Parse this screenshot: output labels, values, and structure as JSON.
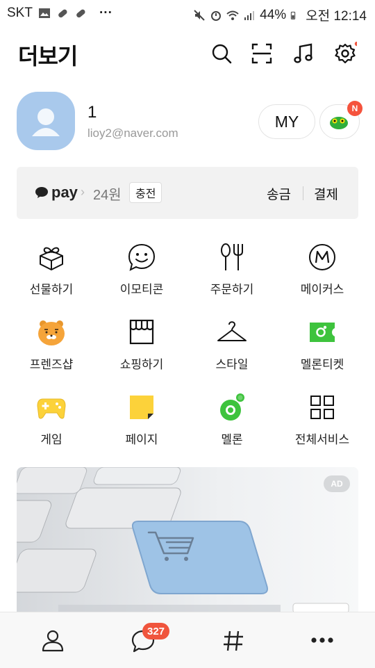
{
  "status_bar": {
    "carrier": "SKT",
    "more_notifications": "···",
    "battery": "44%",
    "time": "오전 12:14"
  },
  "header": {
    "title": "더보기"
  },
  "profile": {
    "name": "1",
    "email": "lioy2@naver.com",
    "my_label": "MY",
    "badge": "N"
  },
  "pay": {
    "logo": "pay",
    "amount": "24원",
    "charge": "충전",
    "send": "송금",
    "payment": "결제"
  },
  "grid": [
    {
      "label": "선물하기",
      "icon": "gift-icon"
    },
    {
      "label": "이모티콘",
      "icon": "emoticon-icon"
    },
    {
      "label": "주문하기",
      "icon": "fork-spoon-icon"
    },
    {
      "label": "메이커스",
      "icon": "makers-icon"
    },
    {
      "label": "프렌즈샵",
      "icon": "ryan-icon"
    },
    {
      "label": "쇼핑하기",
      "icon": "shop-icon"
    },
    {
      "label": "스타일",
      "icon": "hanger-icon"
    },
    {
      "label": "멜론티켓",
      "icon": "melon-ticket-icon"
    },
    {
      "label": "게임",
      "icon": "gamepad-icon"
    },
    {
      "label": "페이지",
      "icon": "page-icon"
    },
    {
      "label": "멜론",
      "icon": "melon-icon"
    },
    {
      "label": "전체서비스",
      "icon": "all-services-icon"
    }
  ],
  "banner": {
    "ad_label": "AD"
  },
  "tabbar": {
    "chat_count": "327"
  },
  "colors": {
    "accent_red": "#f0553d",
    "melon_green": "#3ec33d",
    "kakao_yellow": "#fcd23a"
  }
}
